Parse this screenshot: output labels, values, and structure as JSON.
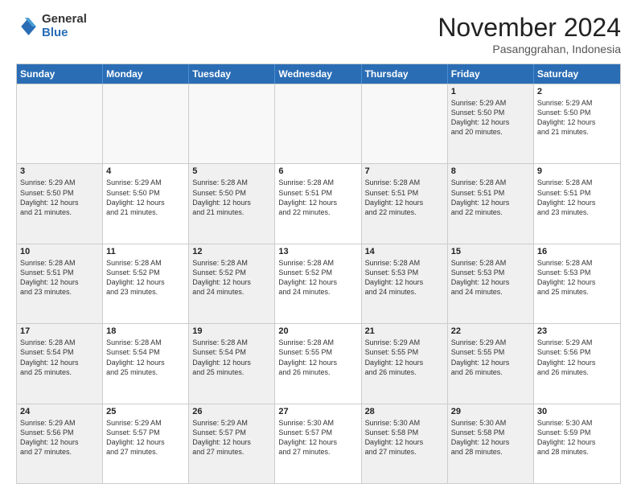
{
  "logo": {
    "general": "General",
    "blue": "Blue"
  },
  "header": {
    "month": "November 2024",
    "location": "Pasanggrahan, Indonesia"
  },
  "days": [
    "Sunday",
    "Monday",
    "Tuesday",
    "Wednesday",
    "Thursday",
    "Friday",
    "Saturday"
  ],
  "rows": [
    [
      {
        "day": "",
        "text": "",
        "empty": true
      },
      {
        "day": "",
        "text": "",
        "empty": true
      },
      {
        "day": "",
        "text": "",
        "empty": true
      },
      {
        "day": "",
        "text": "",
        "empty": true
      },
      {
        "day": "",
        "text": "",
        "empty": true
      },
      {
        "day": "1",
        "text": "Sunrise: 5:29 AM\nSunset: 5:50 PM\nDaylight: 12 hours\nand 20 minutes.",
        "shaded": true
      },
      {
        "day": "2",
        "text": "Sunrise: 5:29 AM\nSunset: 5:50 PM\nDaylight: 12 hours\nand 21 minutes.",
        "shaded": false
      }
    ],
    [
      {
        "day": "3",
        "text": "Sunrise: 5:29 AM\nSunset: 5:50 PM\nDaylight: 12 hours\nand 21 minutes.",
        "shaded": true
      },
      {
        "day": "4",
        "text": "Sunrise: 5:29 AM\nSunset: 5:50 PM\nDaylight: 12 hours\nand 21 minutes.",
        "shaded": false
      },
      {
        "day": "5",
        "text": "Sunrise: 5:28 AM\nSunset: 5:50 PM\nDaylight: 12 hours\nand 21 minutes.",
        "shaded": true
      },
      {
        "day": "6",
        "text": "Sunrise: 5:28 AM\nSunset: 5:51 PM\nDaylight: 12 hours\nand 22 minutes.",
        "shaded": false
      },
      {
        "day": "7",
        "text": "Sunrise: 5:28 AM\nSunset: 5:51 PM\nDaylight: 12 hours\nand 22 minutes.",
        "shaded": true
      },
      {
        "day": "8",
        "text": "Sunrise: 5:28 AM\nSunset: 5:51 PM\nDaylight: 12 hours\nand 22 minutes.",
        "shaded": true
      },
      {
        "day": "9",
        "text": "Sunrise: 5:28 AM\nSunset: 5:51 PM\nDaylight: 12 hours\nand 23 minutes.",
        "shaded": false
      }
    ],
    [
      {
        "day": "10",
        "text": "Sunrise: 5:28 AM\nSunset: 5:51 PM\nDaylight: 12 hours\nand 23 minutes.",
        "shaded": true
      },
      {
        "day": "11",
        "text": "Sunrise: 5:28 AM\nSunset: 5:52 PM\nDaylight: 12 hours\nand 23 minutes.",
        "shaded": false
      },
      {
        "day": "12",
        "text": "Sunrise: 5:28 AM\nSunset: 5:52 PM\nDaylight: 12 hours\nand 24 minutes.",
        "shaded": true
      },
      {
        "day": "13",
        "text": "Sunrise: 5:28 AM\nSunset: 5:52 PM\nDaylight: 12 hours\nand 24 minutes.",
        "shaded": false
      },
      {
        "day": "14",
        "text": "Sunrise: 5:28 AM\nSunset: 5:53 PM\nDaylight: 12 hours\nand 24 minutes.",
        "shaded": true
      },
      {
        "day": "15",
        "text": "Sunrise: 5:28 AM\nSunset: 5:53 PM\nDaylight: 12 hours\nand 24 minutes.",
        "shaded": true
      },
      {
        "day": "16",
        "text": "Sunrise: 5:28 AM\nSunset: 5:53 PM\nDaylight: 12 hours\nand 25 minutes.",
        "shaded": false
      }
    ],
    [
      {
        "day": "17",
        "text": "Sunrise: 5:28 AM\nSunset: 5:54 PM\nDaylight: 12 hours\nand 25 minutes.",
        "shaded": true
      },
      {
        "day": "18",
        "text": "Sunrise: 5:28 AM\nSunset: 5:54 PM\nDaylight: 12 hours\nand 25 minutes.",
        "shaded": false
      },
      {
        "day": "19",
        "text": "Sunrise: 5:28 AM\nSunset: 5:54 PM\nDaylight: 12 hours\nand 25 minutes.",
        "shaded": true
      },
      {
        "day": "20",
        "text": "Sunrise: 5:28 AM\nSunset: 5:55 PM\nDaylight: 12 hours\nand 26 minutes.",
        "shaded": false
      },
      {
        "day": "21",
        "text": "Sunrise: 5:29 AM\nSunset: 5:55 PM\nDaylight: 12 hours\nand 26 minutes.",
        "shaded": true
      },
      {
        "day": "22",
        "text": "Sunrise: 5:29 AM\nSunset: 5:55 PM\nDaylight: 12 hours\nand 26 minutes.",
        "shaded": true
      },
      {
        "day": "23",
        "text": "Sunrise: 5:29 AM\nSunset: 5:56 PM\nDaylight: 12 hours\nand 26 minutes.",
        "shaded": false
      }
    ],
    [
      {
        "day": "24",
        "text": "Sunrise: 5:29 AM\nSunset: 5:56 PM\nDaylight: 12 hours\nand 27 minutes.",
        "shaded": true
      },
      {
        "day": "25",
        "text": "Sunrise: 5:29 AM\nSunset: 5:57 PM\nDaylight: 12 hours\nand 27 minutes.",
        "shaded": false
      },
      {
        "day": "26",
        "text": "Sunrise: 5:29 AM\nSunset: 5:57 PM\nDaylight: 12 hours\nand 27 minutes.",
        "shaded": true
      },
      {
        "day": "27",
        "text": "Sunrise: 5:30 AM\nSunset: 5:57 PM\nDaylight: 12 hours\nand 27 minutes.",
        "shaded": false
      },
      {
        "day": "28",
        "text": "Sunrise: 5:30 AM\nSunset: 5:58 PM\nDaylight: 12 hours\nand 27 minutes.",
        "shaded": true
      },
      {
        "day": "29",
        "text": "Sunrise: 5:30 AM\nSunset: 5:58 PM\nDaylight: 12 hours\nand 28 minutes.",
        "shaded": true
      },
      {
        "day": "30",
        "text": "Sunrise: 5:30 AM\nSunset: 5:59 PM\nDaylight: 12 hours\nand 28 minutes.",
        "shaded": false
      }
    ]
  ]
}
